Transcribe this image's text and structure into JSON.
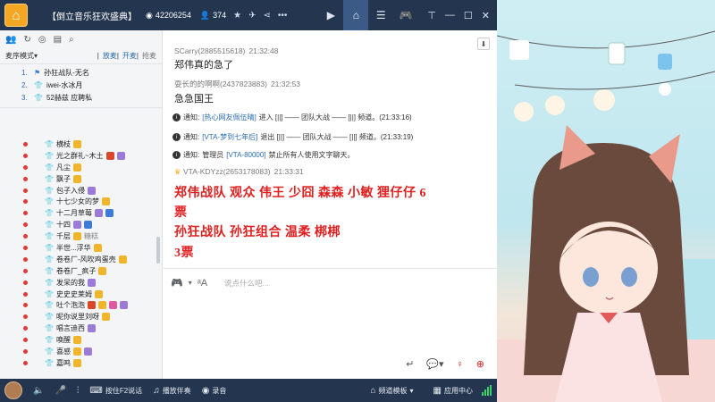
{
  "titlebar": {
    "channel_name": "【倒立音乐狂欢盛典】",
    "channel_id": "42206254",
    "online_count": "374"
  },
  "left": {
    "mode_label": "麦序模式",
    "links": [
      "放麦",
      "开麦",
      "抢麦"
    ],
    "queue": [
      {
        "num": "1.",
        "name": "孙狂战队-无名"
      },
      {
        "num": "2.",
        "name": "iwei-水冰月"
      },
      {
        "num": "3.",
        "name": "52赫兹 应聘私"
      }
    ],
    "users": [
      {
        "name": "横枝",
        "badges": [
          "gold"
        ]
      },
      {
        "name": "光之群礼~木土",
        "badges": [
          "red",
          "purple"
        ]
      },
      {
        "name": "凡尘",
        "badges": [
          "gold"
        ]
      },
      {
        "name": "飘子",
        "badges": [
          "gold"
        ]
      },
      {
        "name": "包子入侵",
        "badges": [
          "purple"
        ]
      },
      {
        "name": "十七少女的梦",
        "badges": [
          "gold"
        ]
      },
      {
        "name": "十二月草莓",
        "badges": [
          "purple",
          "blue"
        ]
      },
      {
        "name": "十四",
        "badges": [
          "purple",
          "blue"
        ]
      },
      {
        "name": "千层",
        "badges": [
          "gold"
        ],
        "extra": "糖糕"
      },
      {
        "name": "半世...浮华",
        "badges": [
          "gold"
        ]
      },
      {
        "name": "卷卷厂-风吹鸡蛋壳",
        "badges": [
          "gold"
        ]
      },
      {
        "name": "卷卷厂_疯子",
        "badges": [
          "gold"
        ]
      },
      {
        "name": "发呆的我",
        "badges": [
          "purple"
        ]
      },
      {
        "name": "史史史莱姆",
        "badges": [
          "gold"
        ]
      },
      {
        "name": "吐个泡泡",
        "badges": [
          "red",
          "gold",
          "pink",
          "purple"
        ]
      },
      {
        "name": "呢你说里刘呀",
        "badges": [
          "gold"
        ]
      },
      {
        "name": "唱言迪西",
        "badges": [
          "purple"
        ]
      },
      {
        "name": "唤醒",
        "badges": [
          "gold"
        ]
      },
      {
        "name": "喜感",
        "badges": [
          "gold",
          "purple"
        ]
      },
      {
        "name": "嘉鸣",
        "badges": [
          "gold"
        ]
      }
    ]
  },
  "chat": {
    "messages": [
      {
        "user": "SCarry(2885515618)",
        "time": "21:32:48",
        "text": "郑伟真的急了"
      },
      {
        "user": "耍长的的啊啊(2437823883)",
        "time": "21:32:53",
        "text": "急急国王"
      }
    ],
    "notices": [
      {
        "label": "通知:",
        "link": "[热心网友佩伍晴]",
        "text": "进入 [||] —— 团队大战 —— [||] 频道。(21:33:16)"
      },
      {
        "label": "通知:",
        "link": "[VTA-梦到七年后]",
        "text": "退出 [||] —— 团队大战 —— [||] 频道。(21:33:19)"
      },
      {
        "label": "通知:",
        "link": "[VTA-80000]",
        "prefix": "管理员",
        "text": "禁止所有人使用文字聊天。"
      }
    ],
    "vote_user": "VTA-KDYzz(2653178083)",
    "vote_time": "21:33:31",
    "vote_lines": [
      "郑伟战队  观众  伟王  少囧  森森  小敏    狸仔仔    6",
      "票",
      "孙狂战队  孙狂组合  温柔  梆梆",
      "3票"
    ]
  },
  "input": {
    "placeholder": "说点什么吧..."
  },
  "bottombar": {
    "ptt_label": "按住F2说话",
    "accompany_label": "播放伴奏",
    "record_label": "录音",
    "template_label": "频道模板",
    "app_center_label": "应用中心"
  }
}
